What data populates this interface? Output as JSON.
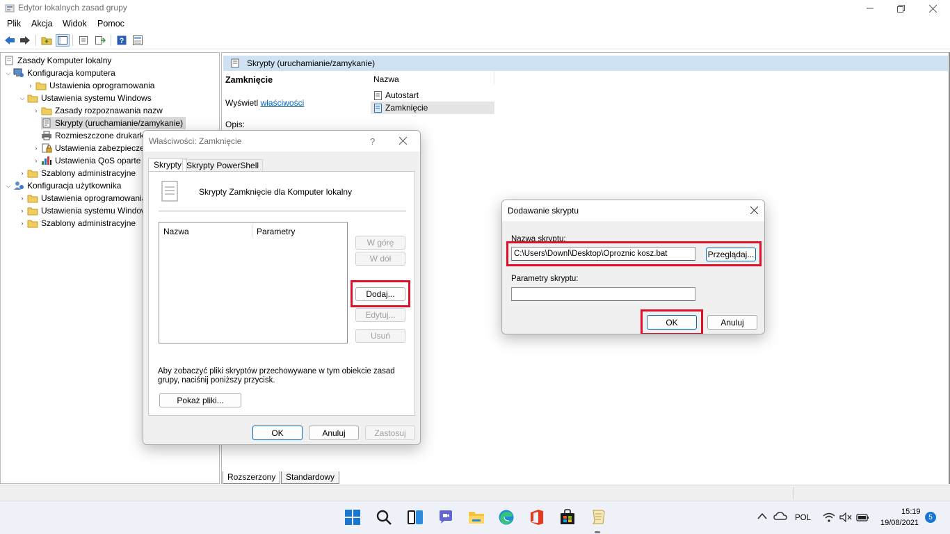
{
  "window": {
    "title": "Edytor lokalnych zasad grupy"
  },
  "menu": [
    "Plik",
    "Akcja",
    "Widok",
    "Pomoc"
  ],
  "tree": {
    "items": [
      {
        "label": "Zasady Komputer lokalny"
      },
      {
        "label": "Konfiguracja komputera"
      },
      {
        "label": "Ustawienia oprogramowania"
      },
      {
        "label": "Ustawienia systemu Windows"
      },
      {
        "label": "Zasady rozpoznawania nazw"
      },
      {
        "label": "Skrypty (uruchamianie/zamykanie)"
      },
      {
        "label": "Rozmieszczone drukarki"
      },
      {
        "label": "Ustawienia zabezpieczeń"
      },
      {
        "label": "Ustawienia QoS oparte"
      },
      {
        "label": "Szablony administracyjne"
      },
      {
        "label": "Konfiguracja użytkownika"
      },
      {
        "label": "Ustawienia oprogramowania"
      },
      {
        "label": "Ustawienia systemu Windows"
      },
      {
        "label": "Szablony administracyjne"
      }
    ]
  },
  "right": {
    "header": "Skrypty (uruchamianie/zamykanie)",
    "section_title": "Zamknięcie",
    "show_prefix": "Wyświetl",
    "show_link": "właściwości",
    "desc_label": "Opis:",
    "list_header": "Nazwa",
    "list_items": [
      "Autostart",
      "Zamknięcie"
    ],
    "bottom_tabs": [
      "Rozszerzony",
      "Standardowy"
    ]
  },
  "props_dialog": {
    "title": "Właściwości: Zamknięcie",
    "help": "?",
    "tabs": [
      "Skrypty",
      "Skrypty PowerShell"
    ],
    "heading": "Skrypty Zamknięcie dla Komputer lokalny",
    "col_name": "Nazwa",
    "col_params": "Parametry",
    "btn_up": "W górę",
    "btn_down": "W dół",
    "btn_add": "Dodaj...",
    "btn_edit": "Edytuj...",
    "btn_remove": "Usuń",
    "info": "Aby zobaczyć pliki skryptów przechowywane w tym obiekcie zasad grupy, naciśnij poniższy przycisk.",
    "btn_show": "Pokaż pliki...",
    "btn_ok": "OK",
    "btn_cancel": "Anuluj",
    "btn_apply": "Zastosuj"
  },
  "add_dialog": {
    "title": "Dodawanie skryptu",
    "name_label": "Nazwa skryptu:",
    "name_value": "C:\\Users\\Downl\\Desktop\\Oproznic kosz.bat",
    "browse": "Przeglądaj...",
    "params_label": "Parametry skryptu:",
    "params_value": "",
    "btn_ok": "OK",
    "btn_cancel": "Anuluj"
  },
  "taskbar": {
    "lang": "POL",
    "time": "15:19",
    "date": "19/08/2021",
    "notifications": "5"
  },
  "colors": {
    "accent": "#0067c0",
    "highlight_red": "#e0102a",
    "header_blue": "#cfe2f3"
  }
}
